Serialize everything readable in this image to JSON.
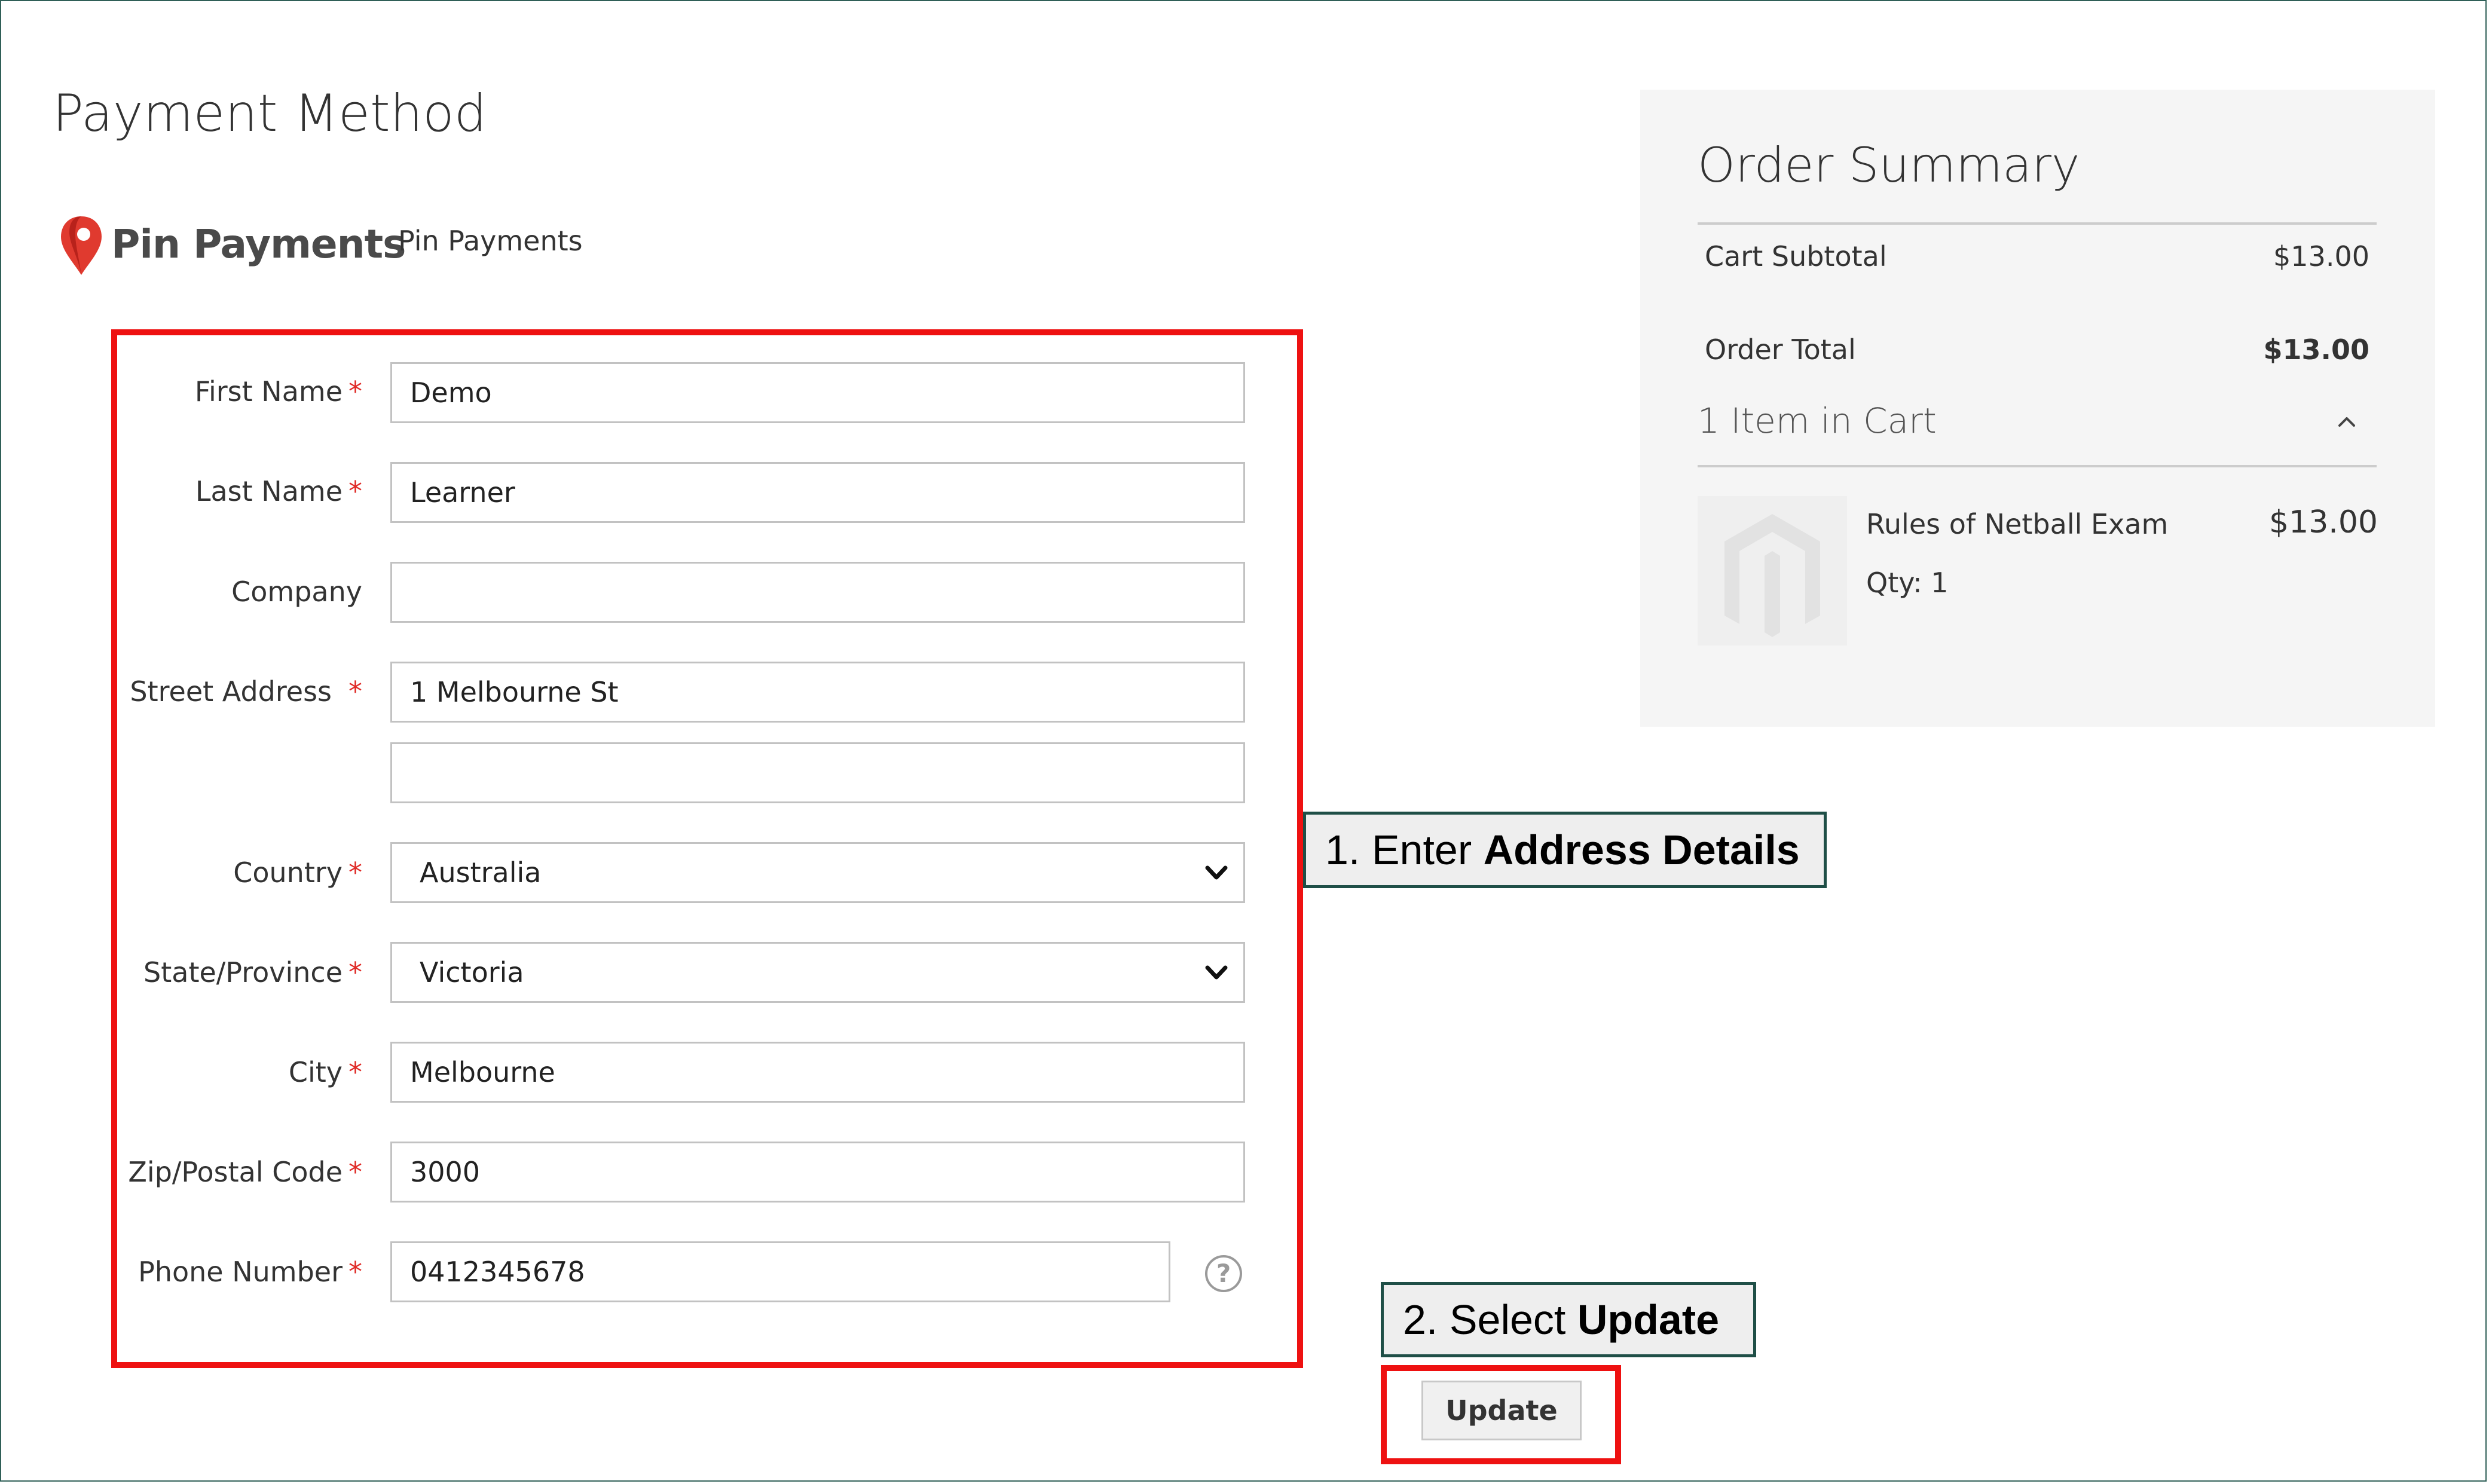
{
  "payment": {
    "title": "Payment Method",
    "brand": "Pin Payments",
    "method_label": "Pin Payments"
  },
  "form": {
    "first_name": {
      "label": "First Name",
      "value": "Demo",
      "required": "*"
    },
    "last_name": {
      "label": "Last Name",
      "value": "Learner",
      "required": "*"
    },
    "company": {
      "label": "Company",
      "value": ""
    },
    "street": {
      "label": "Street Address",
      "value1": "1 Melbourne St",
      "value2": "",
      "required": "*"
    },
    "country": {
      "label": "Country",
      "value": "Australia",
      "required": "*"
    },
    "state": {
      "label": "State/Province",
      "value": "Victoria",
      "required": "*"
    },
    "city": {
      "label": "City",
      "value": "Melbourne",
      "required": "*"
    },
    "zip": {
      "label": "Zip/Postal Code",
      "value": "3000",
      "required": "*"
    },
    "phone": {
      "label": "Phone Number",
      "value": "0412345678",
      "required": "*",
      "help": "?"
    }
  },
  "callouts": {
    "step1_prefix": "1. Enter ",
    "step1_bold": "Address Details",
    "step2_prefix": "2. Select ",
    "step2_bold": "Update"
  },
  "actions": {
    "update_label": "Update"
  },
  "summary": {
    "title": "Order Summary",
    "subtotal_label": "Cart Subtotal",
    "subtotal_value": "$13.00",
    "total_label": "Order Total",
    "total_value": "$13.00",
    "items_label": "1 Item in Cart",
    "item": {
      "name": "Rules of Netball Exam",
      "price": "$13.00",
      "qty": "Qty: 1"
    }
  },
  "colors": {
    "highlight": "#ee1111",
    "callout_border": "#1f4f47",
    "required": "#e02b27",
    "brand_pin": "#e03a2f"
  }
}
